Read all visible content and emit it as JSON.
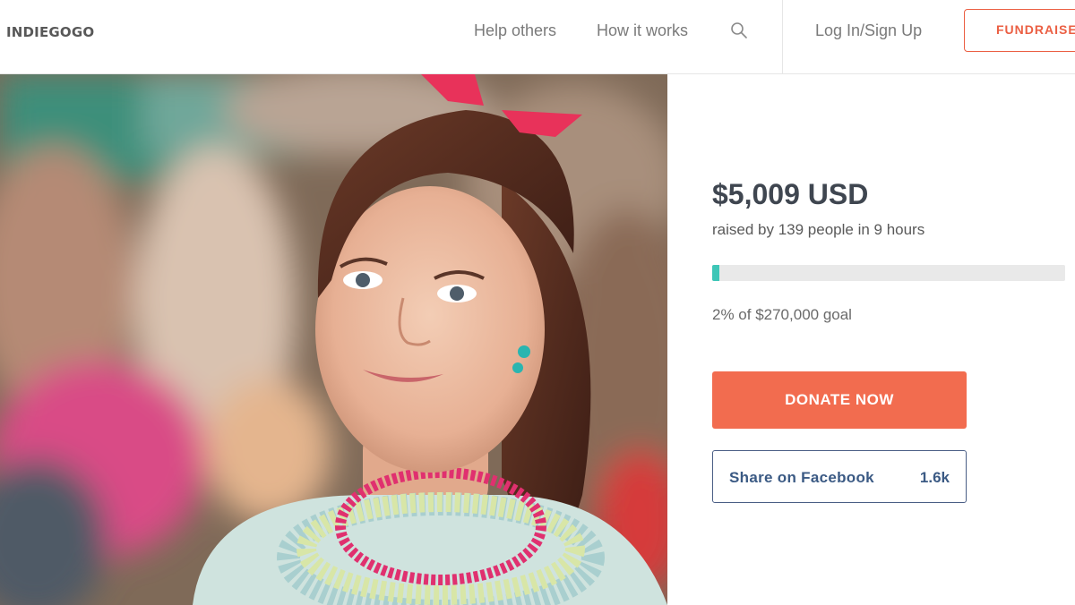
{
  "header": {
    "logo": "INDIEGOGO",
    "nav": {
      "help_others": "Help others",
      "how_it_works": "How it works",
      "login": "Log In/Sign Up",
      "fundraise": "FUNDRAISE"
    }
  },
  "campaign": {
    "amount": "$5,009 USD",
    "raised_text": "raised by 139 people in 9 hours",
    "progress_percent": 2,
    "goal_text": "2% of $270,000 goal",
    "donate_label": "DONATE NOW",
    "share_label": "Share on Facebook",
    "share_count": "1.6k"
  },
  "colors": {
    "accent": "#f26c4f",
    "progress": "#3ec6b7",
    "facebook": "#3b5a84"
  }
}
